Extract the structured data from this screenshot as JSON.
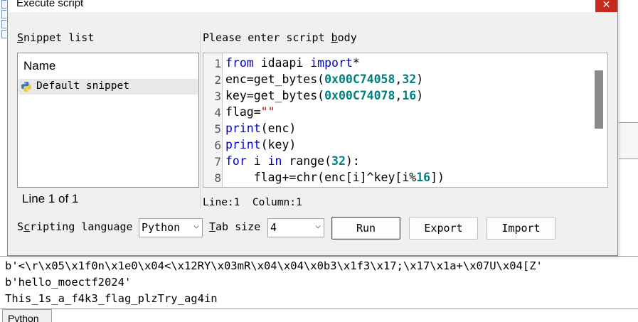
{
  "dialog": {
    "title": "Execute script",
    "close_icon": "close-icon",
    "snippet_list_label": "Snippet list",
    "snippet_list_label_accel": "S",
    "snippet_list_label_rest": "nippet list",
    "snippet_list_header": "Name",
    "snippets": [
      {
        "label": "Default snippet",
        "icon": "python-icon",
        "selected": true
      }
    ],
    "line_count": "Line 1 of 1",
    "script_body_label_pre": "Please enter script ",
    "script_body_label_accel": "b",
    "script_body_label_post": "ody",
    "code_lines": [
      {
        "n": "1",
        "kw1": "from",
        "t1": " idaapi ",
        "kw2": "import",
        "t2": "*"
      },
      {
        "n": "2",
        "t1": "enc=get_bytes(",
        "num1": "0x00C74058",
        "t2": ",",
        "num2": "32",
        "t3": ")"
      },
      {
        "n": "3",
        "t1": "key=get_bytes(",
        "num1": "0x00C74078",
        "t2": ",",
        "num2": "16",
        "t3": ")"
      },
      {
        "n": "4",
        "t1": "flag=",
        "str": "\"\""
      },
      {
        "n": "5",
        "kw1": "print",
        "t1": "(enc)"
      },
      {
        "n": "6",
        "kw1": "print",
        "t1": "(key)"
      },
      {
        "n": "7",
        "kw1": "for",
        "t1": " i ",
        "kw2": "in",
        "t2": " range(",
        "num1": "32",
        "t3": "):"
      },
      {
        "n": "8",
        "t1": "    flag+=chr(enc[i]^key[i%",
        "num1": "16",
        "t2": "])"
      }
    ],
    "status_line": "Line:1",
    "status_column": "Column:1",
    "scripting_language_label_pre": "S",
    "scripting_language_label_accel": "c",
    "scripting_language_label_post": "ripting language",
    "scripting_language_value": "Python",
    "tab_size_label_accel": "T",
    "tab_size_label_post": "ab size",
    "tab_size_value": "4",
    "run_label": "Run",
    "export_label": "Export",
    "import_label": "Import"
  },
  "output": {
    "lines": [
      "b'<\\r\\x05\\x1f0n\\x1e0\\x04<\\x12RY\\x03mR\\x04\\x04\\x0b3\\x1f3\\x17;\\x17\\x1a+\\x07U\\x04[Z'",
      "b'hello_moectf2024'",
      "This_1s_a_f4k3_flag_plzTry_ag4in"
    ],
    "tab_label": "Python"
  }
}
